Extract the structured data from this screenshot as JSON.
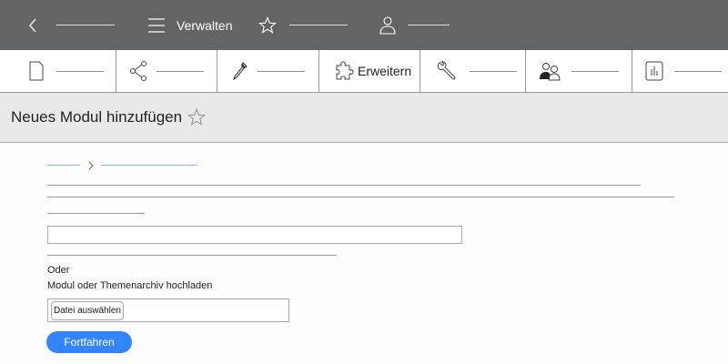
{
  "topbar": {
    "menu_label": "Verwalten"
  },
  "toolbar": {
    "extend_label": "Erweitern"
  },
  "page": {
    "title": "Neues Modul hinzufügen"
  },
  "form": {
    "or_label": "Oder",
    "upload_label": "Modul oder Themenarchiv hochladen",
    "file_button": "Datei auswählen",
    "submit_label": "Fortfahren",
    "url_value": ""
  },
  "colors": {
    "topbar": "#626568",
    "accent": "#3385ff",
    "header": "#e8e9ea"
  }
}
